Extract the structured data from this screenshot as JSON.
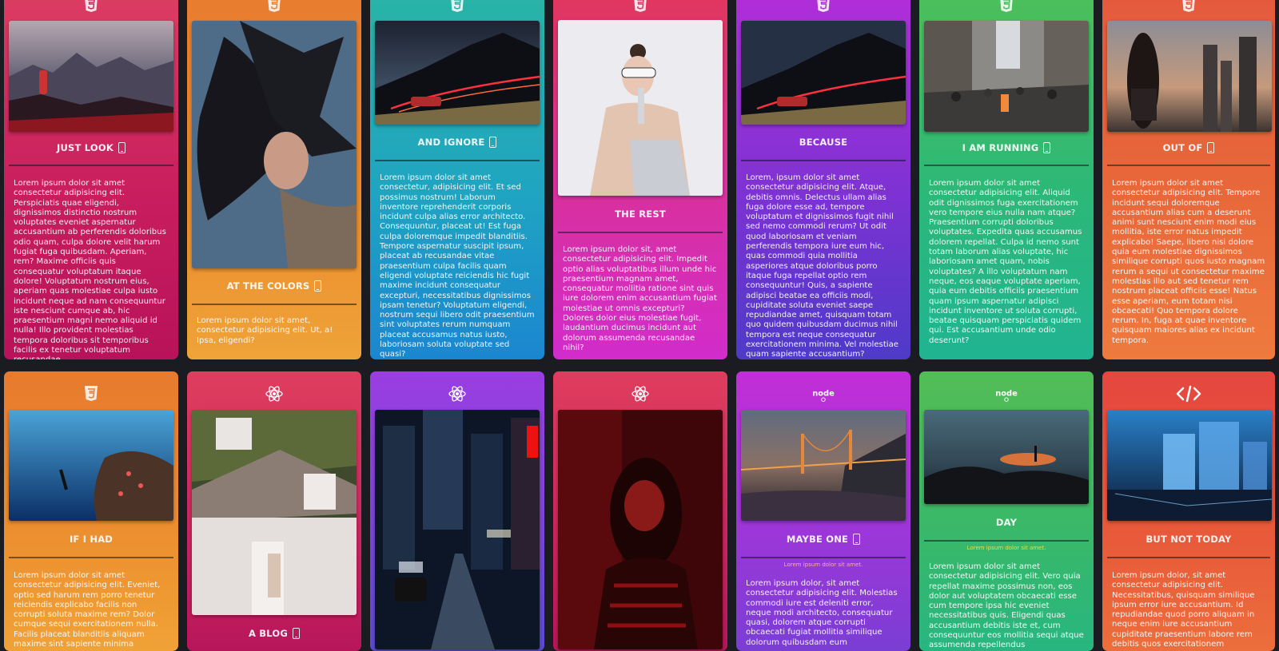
{
  "colors": {
    "background": "#1b1b22"
  },
  "cards": [
    {
      "tech_icon": "html5-icon",
      "title": "JUST LOOK",
      "has_phone_icon": true,
      "photo": "hiker-on-mountain-at-sunset",
      "text": "Lorem ipsum dolor sit amet consectetur adipisicing elit. Perspiciatis quae eligendi, dignissimos distinctio nostrum voluptates eveniet aspernatur accusantium ab perferendis doloribus odio quam, culpa dolore velit harum fugiat fuga quibusdam. Aperiam, rem? Maxime officiis quis consequatur voluptatum itaque dolore! Voluptatum nostrum eius, aperiam quas molestiae culpa iusto incidunt neque ad nam consequuntur iste nesciunt cumque ab, hic praesentium magni nemo aliquid id nulla! Illo provident molestias tempora doloribus sit temporibus facilis ex tenetur voluptatum recusandae."
    },
    {
      "tech_icon": "html5-icon",
      "title": "AT THE COLORS",
      "has_phone_icon": true,
      "photo": "woman-with-spread-hair",
      "text": "Lorem ipsum dolor sit amet, consectetur adipisicing elit. Ut, a! Ipsa, eligendi?"
    },
    {
      "tech_icon": "html5-icon",
      "title": "AND IGNORE",
      "has_phone_icon": true,
      "photo": "car-light-trails-night",
      "text": "Lorem ipsum dolor sit amet consectetur, adipisicing elit. Et sed possimus nostrum! Laborum inventore reprehenderit corporis incidunt culpa alias error architecto. Consequuntur, placeat ut! Est fuga culpa doloremque impedit blanditiis. Tempore aspernatur suscipit ipsum, placeat ab recusandae vitae praesentium culpa facilis quam eligendi voluptate reiciendis hic fugit maxime incidunt consequatur excepturi, necessitatibus dignissimos ipsam tenetur? Voluptatum eligendi, nostrum sequi libero odit praesentium sint voluptates rerum numquam placeat accusamus natus iusto, laboriosam soluta voluptate sed quasi?"
    },
    {
      "tech_icon": "html5-icon",
      "title": "THE REST",
      "has_phone_icon": false,
      "photo": "woman-with-sunglasses",
      "text": "Lorem ipsum dolor sit, amet consectetur adipisicing elit. Impedit optio alias voluptatibus illum unde hic praesentium magnam amet, consequatur mollitia ratione sint quis iure dolorem enim accusantium fugiat molestiae ut omnis excepturi? Dolores dolor eius molestiae fugit, laudantium ducimus incidunt aut dolorum assumenda recusandae nihil?"
    },
    {
      "tech_icon": "html5-icon",
      "title": "BECAUSE",
      "has_phone_icon": false,
      "photo": "car-light-trails-night",
      "text": "Lorem, ipsum dolor sit amet consectetur adipisicing elit. Atque, debitis omnis. Delectus ullam alias fuga dolore esse ad, tempore voluptatum et dignissimos fugit nihil sed nemo commodi rerum? Ut odit quod laboriosam et veniam perferendis tempora iure eum hic, quas commodi quia mollitia asperiores atque doloribus porro itaque fuga repellat optio rem consequuntur! Quis, a sapiente adipisci beatae ea officiis modi, cupiditate soluta eveniet saepe repudiandae amet, quisquam totam quo quidem quibusdam ducimus nihil tempora est neque consequatur exercitationem minima. Vel molestiae quam sapiente accusantium?"
    },
    {
      "tech_icon": "html5-icon",
      "title": "I AM RUNNING",
      "has_phone_icon": true,
      "photo": "crowded-city-street",
      "text": "Lorem ipsum dolor sit amet consectetur adipisicing elit. Aliquid odit dignissimos fuga exercitationem vero tempore eius nulla nam atque? Praesentium corrupti doloribus voluptates. Expedita quas accusamus dolorem repellat. Culpa id nemo sunt totam laborum alias voluptate, hic laboriosam amet quam, nobis voluptates? A illo voluptatum nam neque, eos eaque voluptate aperiam, quia eum debitis officiis praesentium quam ipsum aspernatur adipisci incidunt inventore ut soluta corrupti, beatae quisquam perspiciatis quidem qui. Est accusantium unde odio deserunt?"
    },
    {
      "tech_icon": "html5-icon",
      "title": "OUT OF",
      "has_phone_icon": true,
      "photo": "woman-city-skyline-sunset",
      "text": "Lorem ipsum dolor sit amet consectetur adipisicing elit. Tempore incidunt sequi doloremque accusantium alias cum a deserunt animi sunt nesciunt enim modi eius mollitia, iste error natus impedit explicabo! Saepe, libero nisi dolore quia eum molestiae dignissimos similique corrupti quos iusto magnam rerum a sequi ut consectetur maxime molestias illo aut sed tenetur rem nostrum placeat officiis esse! Natus esse aperiam, eum totam nisi obcaecati! Quo tempora dolore rerum. In, fuga at quae inventore quisquam maiores alias ex incidunt tempora."
    },
    {
      "tech_icon": "css3-icon",
      "title": "IF I HAD",
      "has_phone_icon": false,
      "photo": "diver-near-coral-reef",
      "text": "Lorem ipsum dolor sit amet consectetur adipisicing elit. Eveniet, optio sed harum rem porro tenetur reiciendis explicabo facilis non corrupti soluta maxime rem? Dolor cumque sequi exercitationem nulla. Facilis placeat blanditiis aliquam maxime sint sapiente minima nostrum"
    },
    {
      "tech_icon": "react-icon",
      "title": "A BLOG",
      "has_phone_icon": true,
      "photo": "woman-by-white-house"
    },
    {
      "tech_icon": "react-icon",
      "title": "",
      "has_phone_icon": false,
      "photo": "city-street-at-night"
    },
    {
      "tech_icon": "react-icon",
      "title": "",
      "has_phone_icon": false,
      "photo": "woman-in-red-light"
    },
    {
      "tech_icon": "node-icon",
      "title": "MAYBE ONE",
      "has_phone_icon": true,
      "photo": "golden-gate-bridge-at-night",
      "mini": "Lorem ipsum dolor sit amet.",
      "text": "Lorem ipsum dolor, sit amet consectetur adipisicing elit. Molestias commodi iure est deleniti error, neque modi architecto, consequatur quasi, dolorem atque corrupti obcaecati fugiat mollitia similique dolorum quibusdam eum"
    },
    {
      "tech_icon": "node-icon",
      "title": "DAY",
      "has_phone_icon": false,
      "photo": "silhouette-hill-at-dusk",
      "mini": "Lorem ipsum dolor sit amet.",
      "text": "Lorem ipsum dolor sit amet consectetur adipisicing elit. Vero quia repellat maxime possimus non, eos dolor aut voluptatem obcaecati esse cum tempore ipsa hic eveniet necessitatibus quis. Eligendi quas accusantium debitis iste et, cum consequuntur eos mollitia sequi atque assumenda repellendus"
    },
    {
      "tech_icon": "code-icon",
      "title": "BUT NOT TODAY",
      "has_phone_icon": false,
      "photo": "glowing-city-buildings-at-night",
      "text": "Lorem ipsum dolor, sit amet consectetur adipisicing elit. Necessitatibus, quisquam similique ipsum error iure accusantium. Id repudiandae quod porro aliquam in neque enim iure accusantium cupiditate praesentium labore rem debitis quos exercitationem"
    }
  ]
}
